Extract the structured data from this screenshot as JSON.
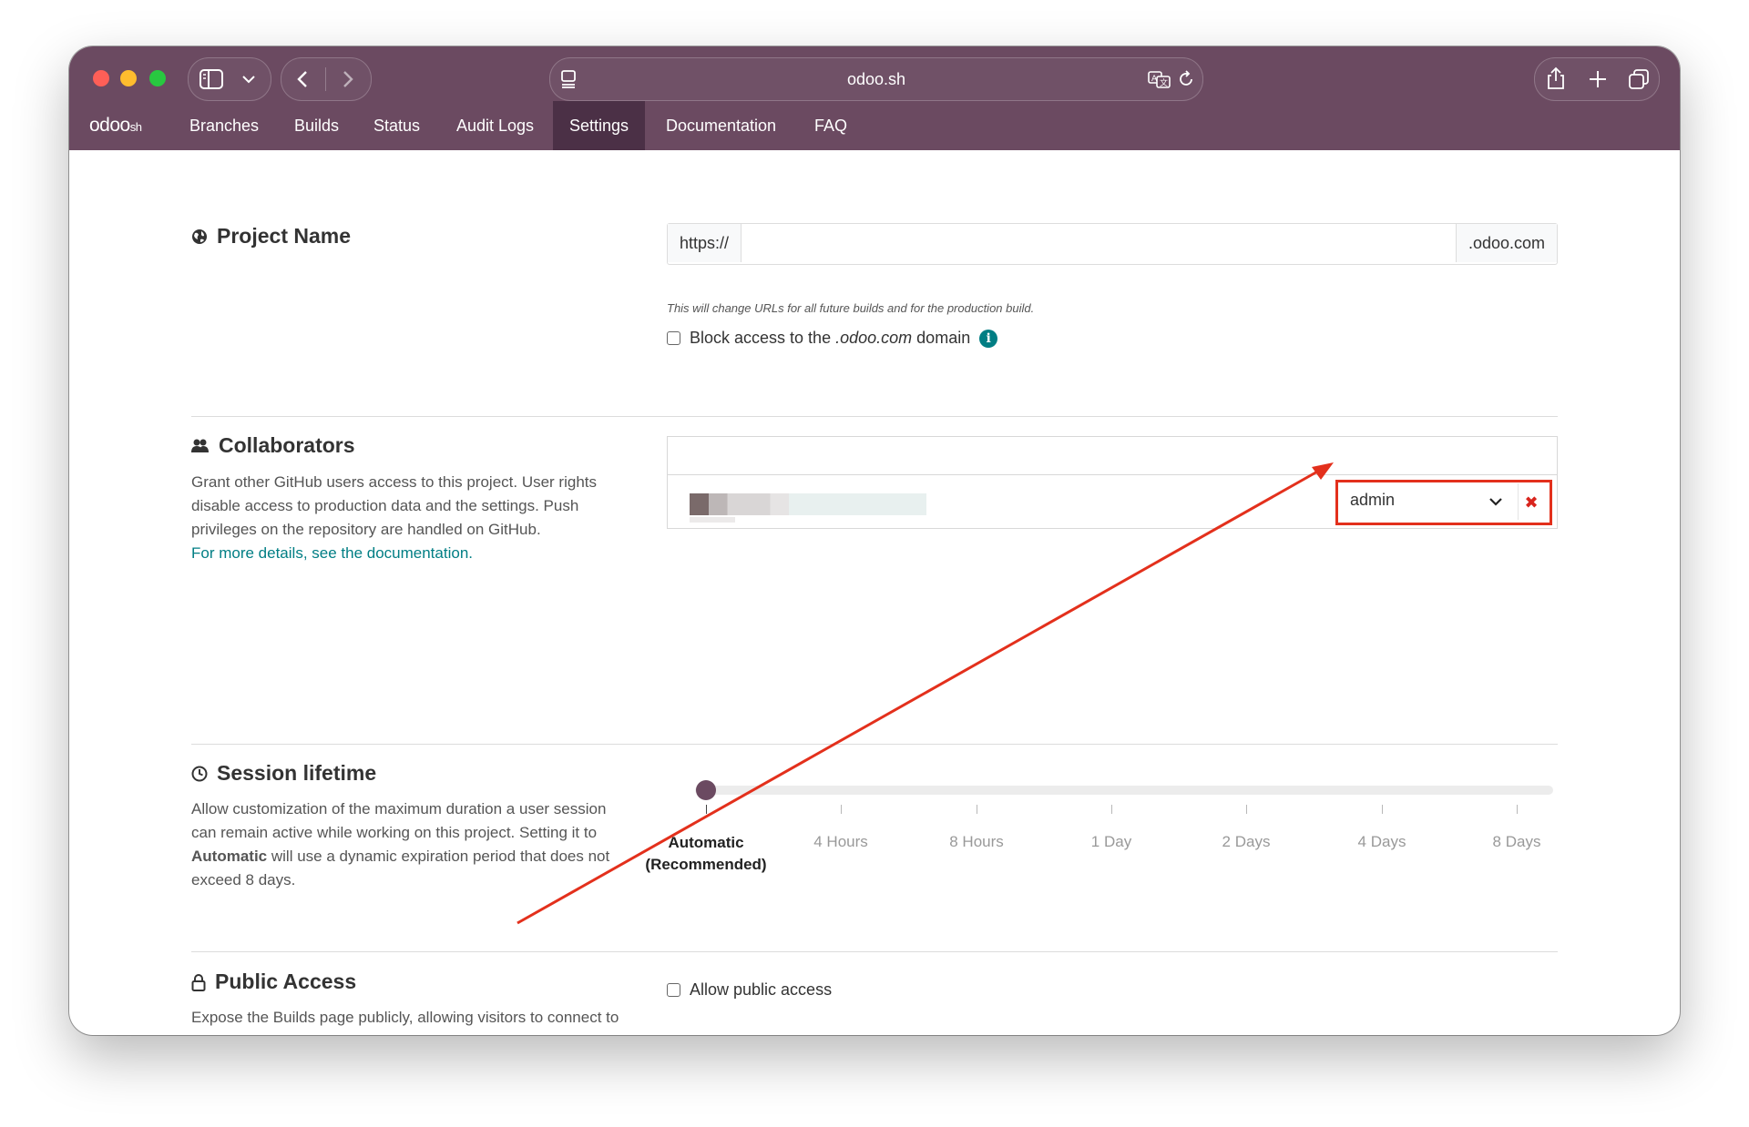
{
  "browser": {
    "url": "odoo.sh"
  },
  "navbar": {
    "logo": "odoo",
    "logo_suffix": "sh",
    "items": [
      {
        "label": "Branches"
      },
      {
        "label": "Builds"
      },
      {
        "label": "Status"
      },
      {
        "label": "Audit Logs"
      },
      {
        "label": "Settings",
        "active": true
      },
      {
        "label": "Documentation"
      },
      {
        "label": "FAQ"
      }
    ]
  },
  "project_name": {
    "title": "Project Name",
    "prefix": "https://",
    "suffix": ".odoo.com",
    "value": "",
    "hint": "This will change URLs for all future builds and for the production build.",
    "block_label_start": "Block access to the",
    "block_label_domain": ".odoo.com",
    "block_label_end": "domain",
    "block_checked": false
  },
  "collaborators": {
    "title": "Collaborators",
    "description": "Grant other GitHub users access to this project. User rights disable access to production data and the settings. Push privileges on the repository are handled on GitHub.",
    "link": "For more details, see the documentation.",
    "search_value": "",
    "rows": [
      {
        "role": "admin"
      }
    ]
  },
  "session_lifetime": {
    "title": "Session lifetime",
    "description_start": "Allow customization of the maximum duration a user session can remain active while working on this project. Setting it to",
    "description_bold": "Automatic",
    "description_end": "will use a dynamic expiration period that does not exceed 8 days.",
    "selected_index": 0,
    "options": [
      {
        "line1": "Automatic",
        "line2": "(Recommended)"
      },
      {
        "line1": "4 Hours",
        "line2": ""
      },
      {
        "line1": "8 Hours",
        "line2": ""
      },
      {
        "line1": "1 Day",
        "line2": ""
      },
      {
        "line1": "2 Days",
        "line2": ""
      },
      {
        "line1": "4 Days",
        "line2": ""
      },
      {
        "line1": "8 Days",
        "line2": ""
      }
    ]
  },
  "public_access": {
    "title": "Public Access",
    "description": "Expose the Builds page publicly, allowing visitors to connect to your development builds.",
    "checkbox_label": "Allow public access",
    "checked": false
  },
  "colors": {
    "brand": "#6b4a61",
    "nav_active": "#4b3046",
    "link": "#017e84",
    "annotation": "#e3301c"
  }
}
